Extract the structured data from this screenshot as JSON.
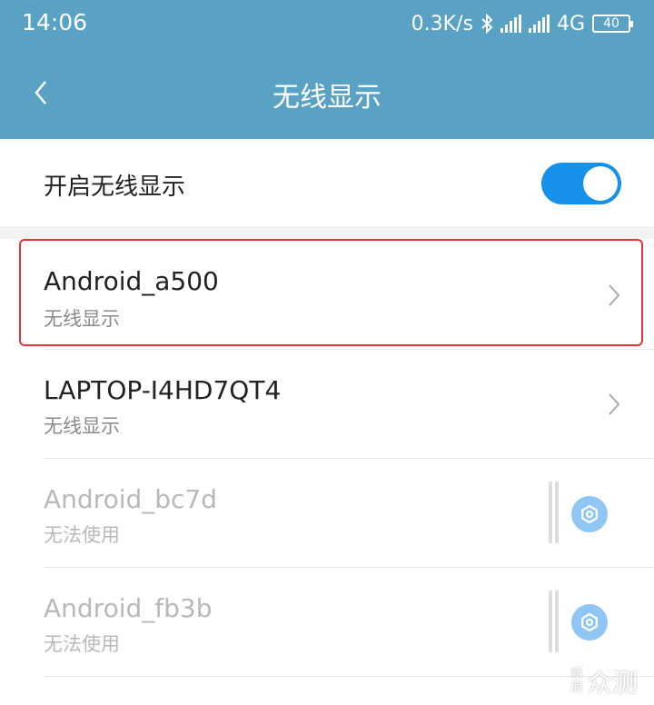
{
  "status_bar": {
    "time": "14:06",
    "net_speed": "0.3K/s",
    "network": "4G",
    "battery": "40"
  },
  "header": {
    "title": "无线显示"
  },
  "toggle": {
    "label": "开启无线显示",
    "state": "on"
  },
  "devices": [
    {
      "name": "Android_a500",
      "status": "无线显示",
      "available": true
    },
    {
      "name": "LAPTOP-I4HD7QT4",
      "status": "无线显示",
      "available": true
    },
    {
      "name": "Android_bc7d",
      "status": "无法使用",
      "available": false
    },
    {
      "name": "Android_fb3b",
      "status": "无法使用",
      "available": false
    }
  ],
  "watermark": {
    "small": "新浪",
    "large": "众测"
  },
  "colors": {
    "header": "#5aa2c3",
    "switch_on": "#1591ea",
    "highlight": "#e3353b",
    "gear": "#90c6f3"
  }
}
